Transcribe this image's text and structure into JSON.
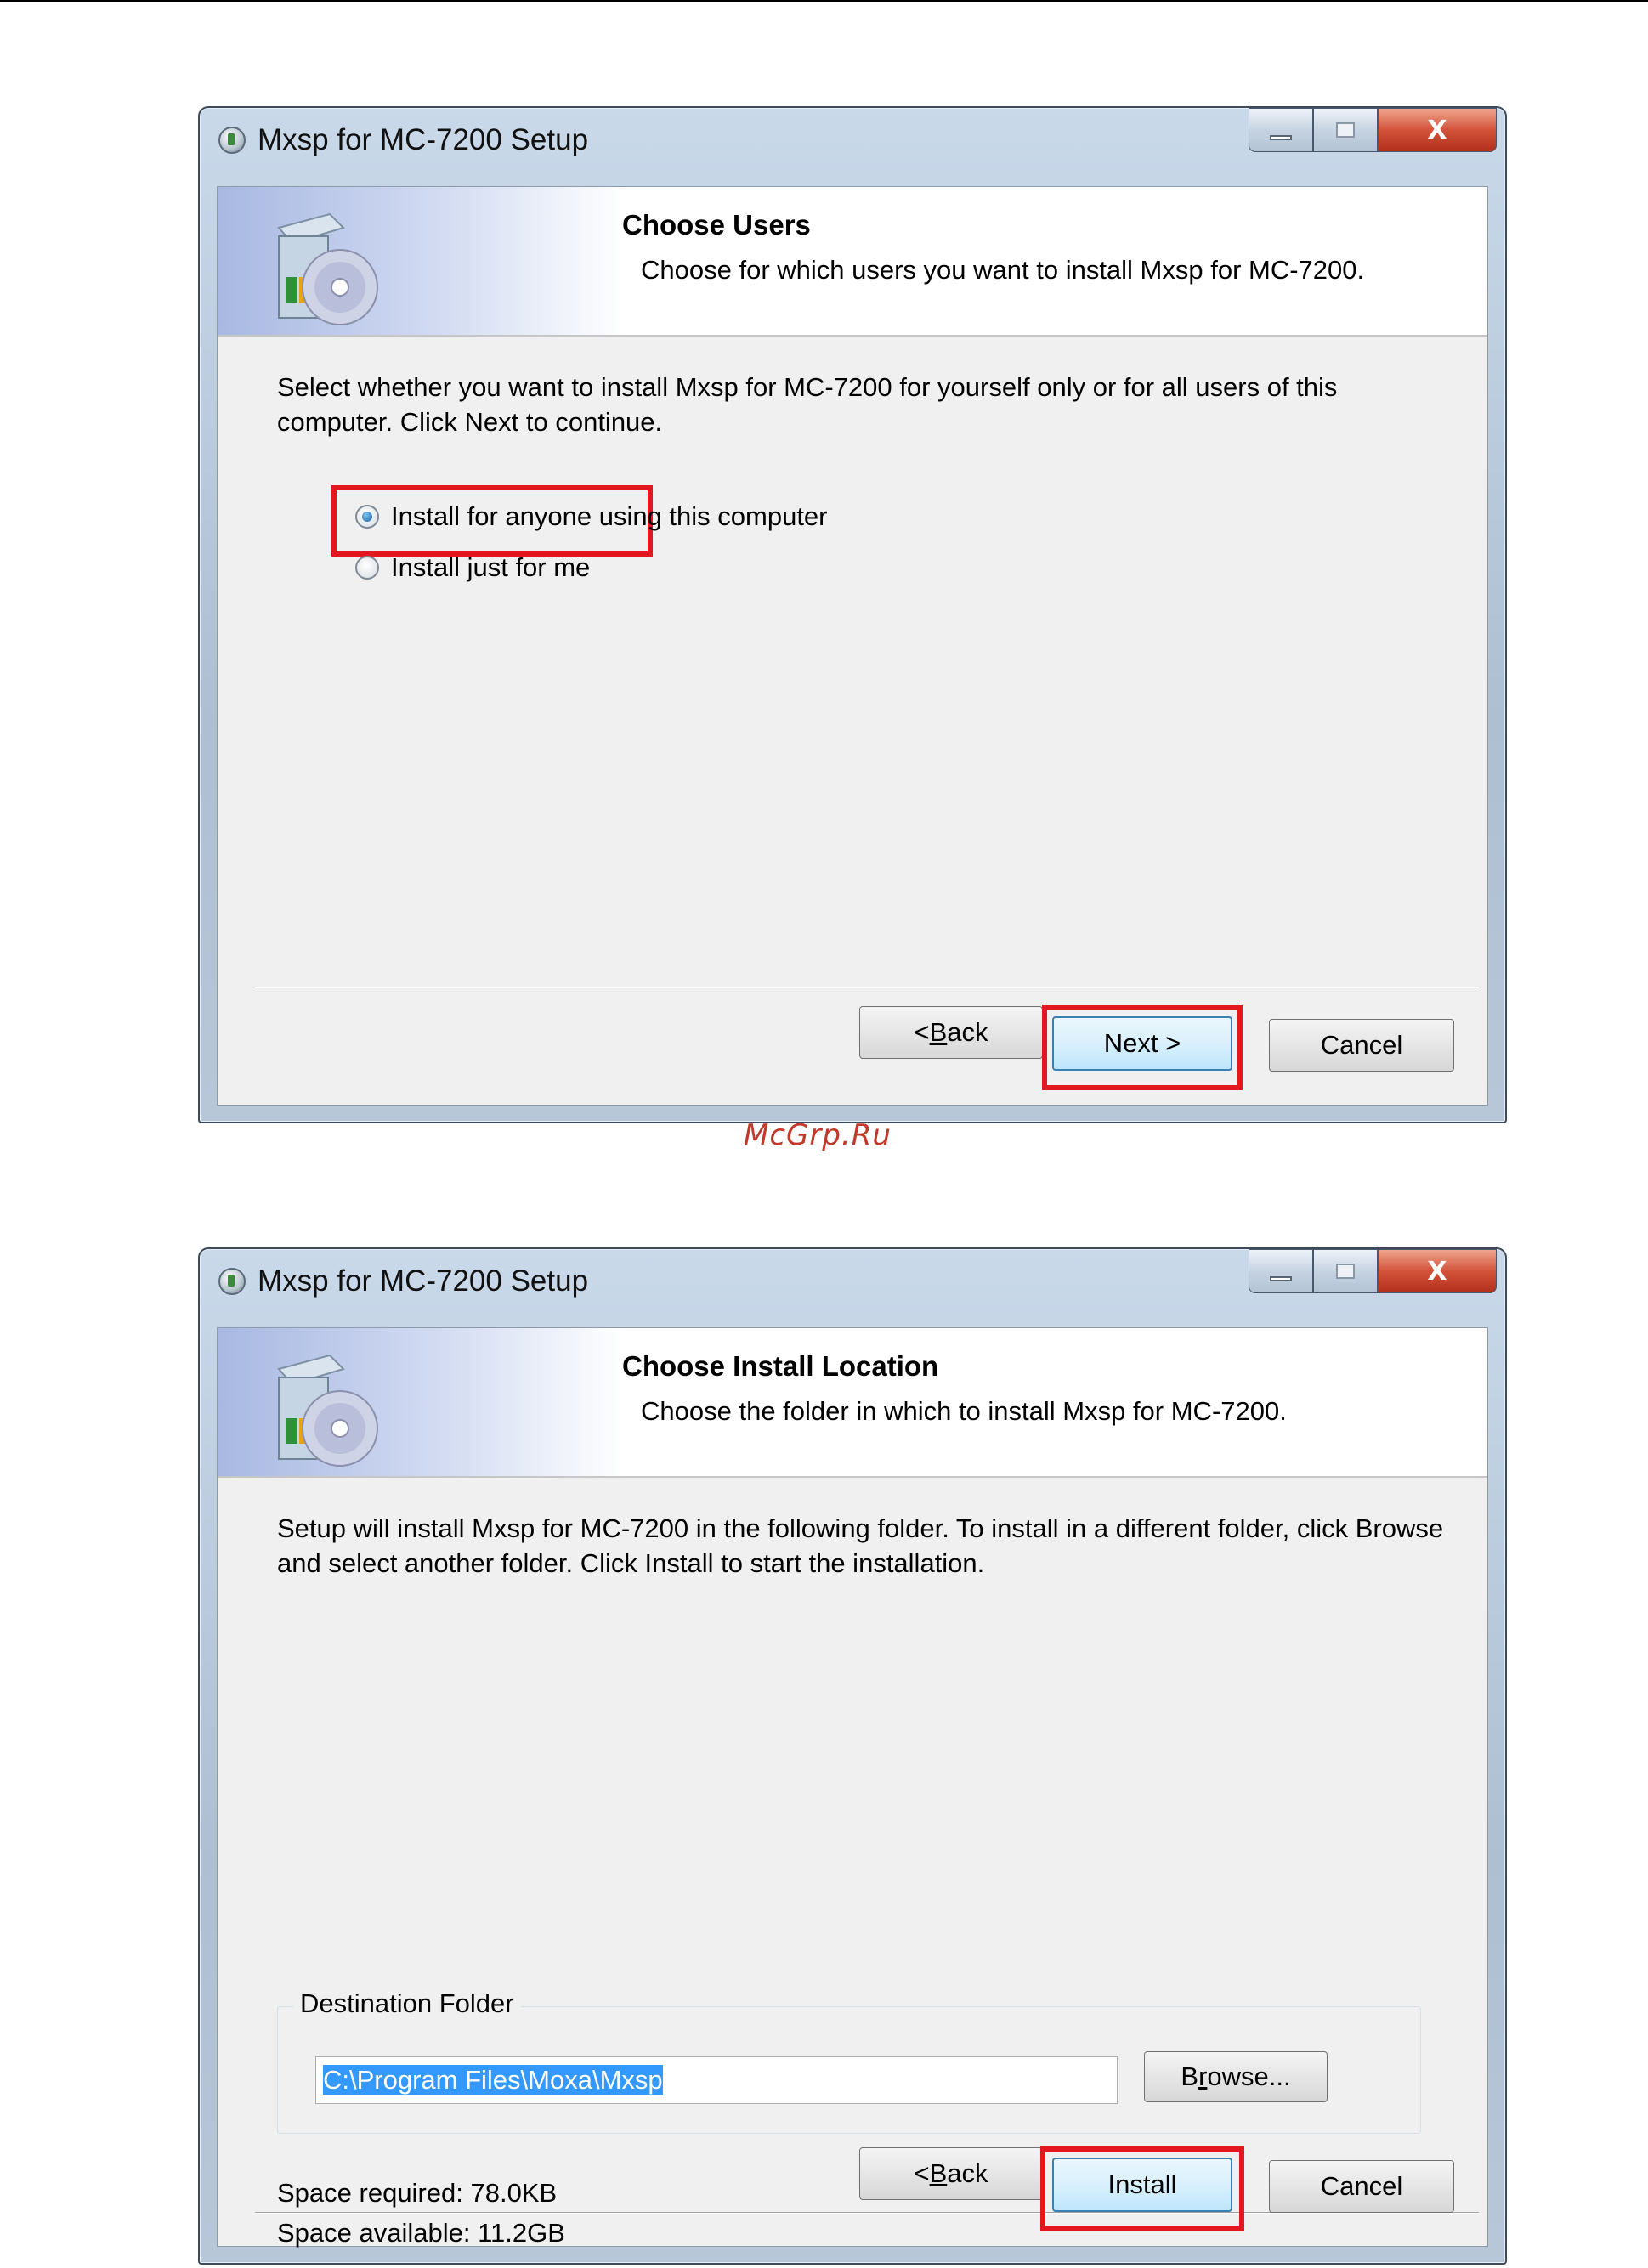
{
  "watermark": "McGrp.Ru",
  "window_title": "Mxsp for MC-7200 Setup",
  "caption_close": "X",
  "dialog1": {
    "header_title": "Choose Users",
    "header_subtitle": "Choose for which users you want to install Mxsp for MC-7200.",
    "description": "Select whether you want to install Mxsp for MC-7200 for yourself only or for all users of this computer. Click Next to continue.",
    "options": [
      {
        "label": "Install for anyone using this computer",
        "selected": true
      },
      {
        "label": "Install just for me",
        "selected": false
      }
    ],
    "back_prefix": "< ",
    "back_accel": "B",
    "back_rest": "ack",
    "next_label": "Next >",
    "cancel_label": "Cancel"
  },
  "dialog2": {
    "header_title": "Choose Install Location",
    "header_subtitle": "Choose the folder in which to install Mxsp for MC-7200.",
    "description": "Setup will install Mxsp for MC-7200 in the following folder. To install in a different folder, click Browse and select another folder. Click Install to start the installation.",
    "group_label": "Destination Folder",
    "path_value": "C:\\Program Files\\Moxa\\Mxsp",
    "browse_prefix": "B",
    "browse_accel": "r",
    "browse_rest": "owse...",
    "space_required": "Space required: 78.0KB",
    "space_available": "Space available: 11.2GB",
    "back_prefix": "< ",
    "back_accel": "B",
    "back_rest": "ack",
    "install_label": "Install",
    "cancel_label": "Cancel"
  },
  "colors": {
    "highlight": "#e3171f",
    "selection": "#3399ff",
    "watermark": "#c0392b"
  },
  "icons": [
    "setup-app-icon",
    "installer-box-cd-icon",
    "minimize-icon",
    "maximize-icon",
    "close-icon"
  ]
}
